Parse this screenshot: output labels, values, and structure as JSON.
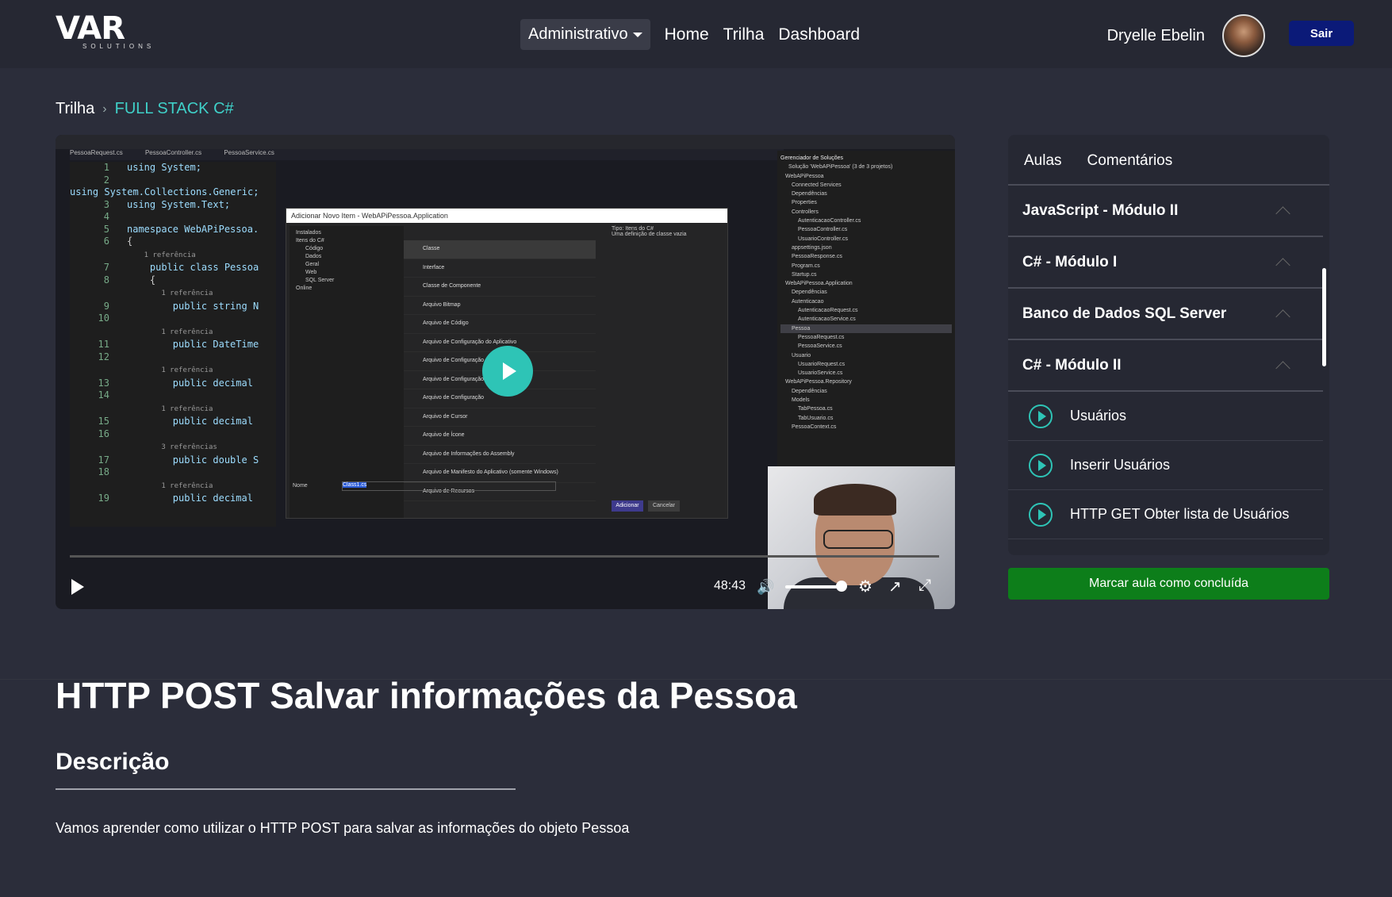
{
  "header": {
    "logo_text": "VAR",
    "logo_sub": "SOLUTIONS",
    "menu_dropdown": "Administrativo",
    "nav": [
      "Home",
      "Trilha",
      "Dashboard"
    ],
    "user_name": "Dryelle Ebelin",
    "logout_label": "Sair"
  },
  "breadcrumb": {
    "root": "Trilha",
    "separator": "›",
    "current": "FULL STACK C#"
  },
  "video": {
    "time": "48:43",
    "volume_percent": 85,
    "vs_tabs": [
      "PessoaRequest.cs",
      "PessoaController.cs",
      "PessoaService.cs"
    ],
    "code_lines": [
      {
        "n": "1",
        "t": "using System;"
      },
      {
        "n": "2",
        "t": "using System.Collections.Generic;"
      },
      {
        "n": "3",
        "t": "using System.Text;"
      },
      {
        "n": "4",
        "t": ""
      },
      {
        "n": "5",
        "t": "namespace WebAPiPessoa."
      },
      {
        "n": "6",
        "t": "{"
      },
      {
        "n": "",
        "t": "    1 referência"
      },
      {
        "n": "7",
        "t": "    public class Pessoa"
      },
      {
        "n": "8",
        "t": "    {"
      },
      {
        "n": "",
        "t": "        1 referência"
      },
      {
        "n": "9",
        "t": "        public string N"
      },
      {
        "n": "10",
        "t": ""
      },
      {
        "n": "",
        "t": "        1 referência"
      },
      {
        "n": "11",
        "t": "        public DateTime"
      },
      {
        "n": "12",
        "t": ""
      },
      {
        "n": "",
        "t": "        1 referência"
      },
      {
        "n": "13",
        "t": "        public decimal"
      },
      {
        "n": "14",
        "t": ""
      },
      {
        "n": "",
        "t": "        1 referência"
      },
      {
        "n": "15",
        "t": "        public decimal"
      },
      {
        "n": "16",
        "t": ""
      },
      {
        "n": "",
        "t": "        3 referências"
      },
      {
        "n": "17",
        "t": "        public double S"
      },
      {
        "n": "18",
        "t": ""
      },
      {
        "n": "",
        "t": "        1 referência"
      },
      {
        "n": "19",
        "t": "        public decimal"
      }
    ],
    "dialog_title": "Adicionar Novo Item - WebAPiPessoa.Application",
    "dialog_left": [
      "Instalados",
      "Itens do C#",
      "Código",
      "Dados",
      "Geral",
      "Web",
      "SQL Server",
      "Online"
    ],
    "dialog_items": [
      "Classe",
      "Interface",
      "Classe de Componente",
      "Arquivo Bitmap",
      "Arquivo de Código",
      "Arquivo de Configuração do Aplicativo",
      "Arquivo de Configuração",
      "Arquivo de Configuração",
      "Arquivo de Configuração",
      "Arquivo de Cursor",
      "Arquivo de Ícone",
      "Arquivo de Informações do Assembly",
      "Arquivo de Manifesto do Aplicativo (somente Windows)",
      "Arquivo de Recursos"
    ],
    "dialog_type": "Tipo: Itens do C#",
    "dialog_desc": "Uma definição de classe vazia",
    "dialog_name_label": "Nome",
    "dialog_name_value": "Class1.cs",
    "dialog_add": "Adicionar",
    "dialog_cancel": "Cancelar",
    "solution_title": "Gerenciador de Soluções",
    "solution_items": [
      "Solução 'WebAPiPessoa' (3 de 3 projetos)",
      "WebAPiPessoa",
      "Connected Services",
      "Dependências",
      "Properties",
      "Controllers",
      "AutenticacaoController.cs",
      "PessoaController.cs",
      "UsuarioController.cs",
      "appsettings.json",
      "PessoaResponse.cs",
      "Program.cs",
      "Startup.cs",
      "WebAPiPessoa.Application",
      "Dependências",
      "Autenticacao",
      "AutenticacaoRequest.cs",
      "AutenticacaoService.cs",
      "Pessoa",
      "PessoaRequest.cs",
      "PessoaService.cs",
      "Usuario",
      "UsuarioRequest.cs",
      "UsuarioService.cs",
      "WebAPiPessoa.Repository",
      "Dependências",
      "Models",
      "TabPessoa.cs",
      "TabUsuario.cs",
      "PessoaContext.cs"
    ]
  },
  "panel": {
    "tabs": [
      "Aulas",
      "Comentários"
    ],
    "modules": [
      "JavaScript - Módulo II",
      "C# - Módulo I",
      "Banco de Dados SQL Server",
      "C# - Módulo II"
    ],
    "lessons": [
      "Usuários",
      "Inserir Usuários",
      "HTTP GET Obter lista de Usuários"
    ],
    "done_button": "Marcar aula como concluída"
  },
  "content": {
    "title": "HTTP POST Salvar informações da Pessoa",
    "desc_heading": "Descrição",
    "description": "Vamos aprender como utilizar o HTTP POST para salvar as informações do objeto Pessoa"
  },
  "colors": {
    "accent": "#2ec4b6",
    "logout": "#0b1a78",
    "done": "#0d7e1a",
    "background": "#2b2d3a"
  }
}
